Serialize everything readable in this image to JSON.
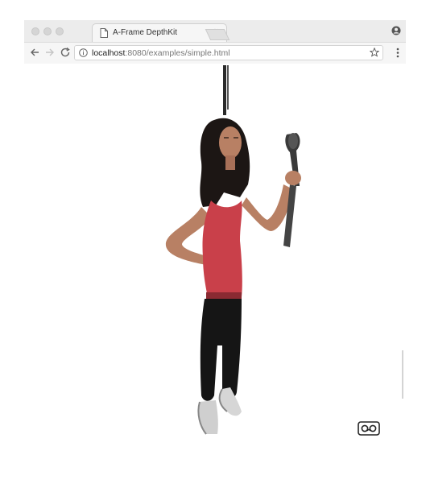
{
  "browser": {
    "tab_title": "A-Frame DepthKit",
    "tab_close_glyph": "×",
    "url_host": "localhost",
    "url_path": ":8080/examples/simple.html",
    "icons": {
      "back": "arrow-left-icon",
      "forward": "arrow-right-icon",
      "reload": "reload-icon",
      "info": "info-icon",
      "bookmark": "star-icon",
      "menu": "kebab-menu-icon",
      "profile": "profile-icon"
    }
  },
  "scene": {
    "content": "volumetric-video-figure",
    "vr_button_icon": "vr-headset-icon",
    "background": "#ffffff"
  },
  "colors": {
    "chrome": "#ececec",
    "toolbar": "#f6f6f6",
    "shirt": "#c9404a",
    "pants": "#151515",
    "skin": "#b88064",
    "hair": "#1c1614"
  }
}
